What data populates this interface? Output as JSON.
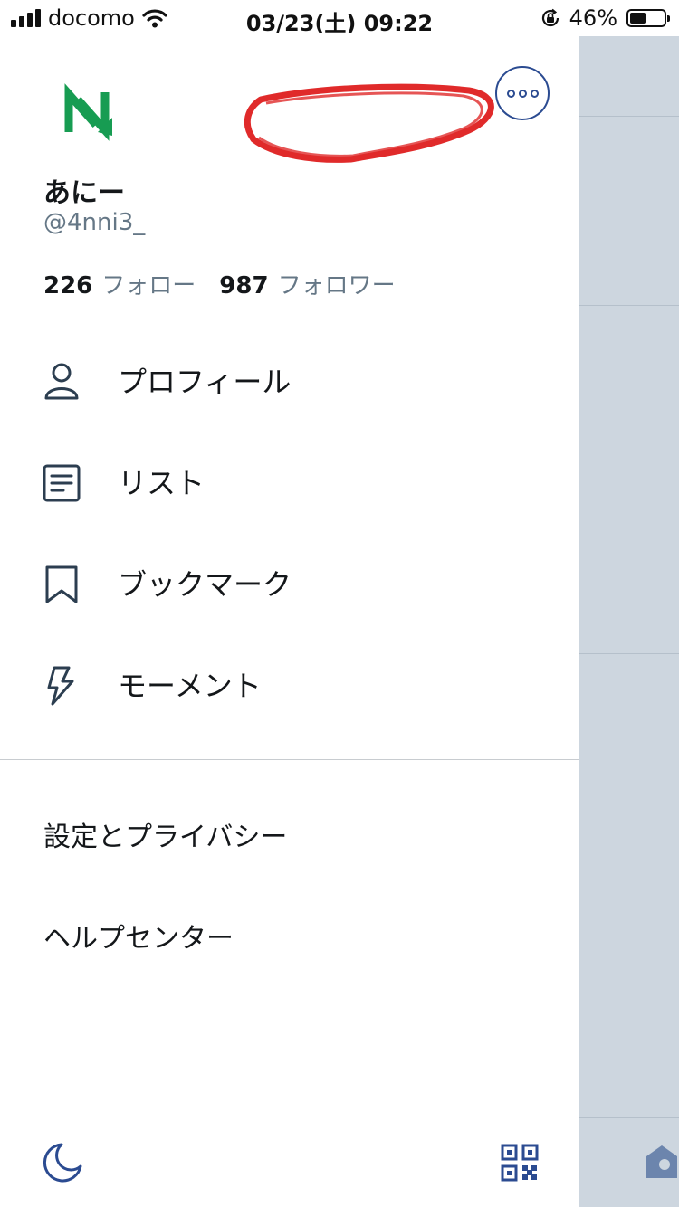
{
  "status_bar": {
    "carrier": "docomo",
    "datetime": "03/23(土) 09:22",
    "battery_percent": "46%",
    "battery_level": 0.46
  },
  "profile": {
    "display_name": "あにー",
    "handle": "@4nni3_",
    "following_count": "226",
    "following_label": "フォロー",
    "followers_count": "987",
    "followers_label": "フォロワー"
  },
  "menu": {
    "profile": "プロフィール",
    "lists": "リスト",
    "bookmarks": "ブックマーク",
    "moments": "モーメント"
  },
  "secondary": {
    "settings": "設定とプライバシー",
    "help": "ヘルプセンター"
  },
  "icons": {
    "more": "more-circle-icon",
    "night_mode": "moon-icon",
    "qr": "qr-code-icon",
    "profile": "person-icon",
    "lists": "list-icon",
    "bookmarks": "bookmark-icon",
    "moments": "lightning-icon"
  },
  "colors": {
    "accent": "#2b4b91",
    "avatar": "#179c52",
    "scribble": "#e02a2a",
    "background_panel": "#cdd6df"
  }
}
